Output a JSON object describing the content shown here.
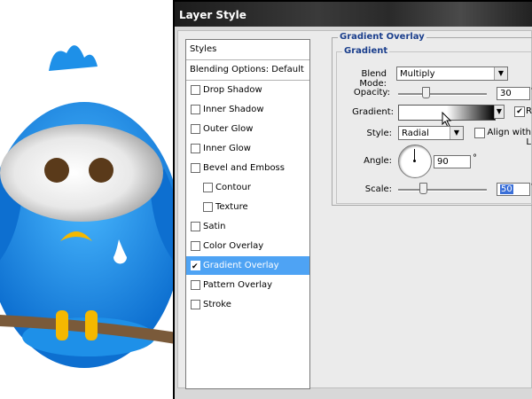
{
  "window": {
    "title": "Layer Style"
  },
  "styles_list": {
    "header": "Styles",
    "blending": "Blending Options: Default",
    "items": [
      {
        "label": "Drop Shadow",
        "checked": false,
        "sub": false
      },
      {
        "label": "Inner Shadow",
        "checked": false,
        "sub": false
      },
      {
        "label": "Outer Glow",
        "checked": false,
        "sub": false
      },
      {
        "label": "Inner Glow",
        "checked": false,
        "sub": false
      },
      {
        "label": "Bevel and Emboss",
        "checked": false,
        "sub": false
      },
      {
        "label": "Contour",
        "checked": false,
        "sub": true
      },
      {
        "label": "Texture",
        "checked": false,
        "sub": true
      },
      {
        "label": "Satin",
        "checked": false,
        "sub": false
      },
      {
        "label": "Color Overlay",
        "checked": false,
        "sub": false
      },
      {
        "label": "Gradient Overlay",
        "checked": true,
        "sub": false,
        "selected": true
      },
      {
        "label": "Pattern Overlay",
        "checked": false,
        "sub": false
      },
      {
        "label": "Stroke",
        "checked": false,
        "sub": false
      }
    ]
  },
  "panel": {
    "title": "Gradient Overlay",
    "section": "Gradient",
    "blend_mode_label": "Blend Mode:",
    "blend_mode_value": "Multiply",
    "opacity_label": "Opacity:",
    "opacity_value": "30",
    "opacity_level": 0.3,
    "gradient_label": "Gradient:",
    "reverse_label": "Re",
    "reverse_checked": true,
    "style_label": "Style:",
    "style_value": "Radial",
    "align_label": "Align with L",
    "align_checked": false,
    "angle_label": "Angle:",
    "angle_value": "90",
    "angle_unit": "°",
    "scale_label": "Scale:",
    "scale_value": "50",
    "scale_level": 0.33,
    "percent": "%"
  },
  "colors": {
    "selection": "#4ea3f4",
    "heading": "#1a3e8c",
    "bird": "#1e90e8"
  },
  "icons": [
    "bird-illustration",
    "checkbox-icon",
    "dropdown-arrow-icon",
    "angle-dial-icon",
    "cursor-icon"
  ]
}
